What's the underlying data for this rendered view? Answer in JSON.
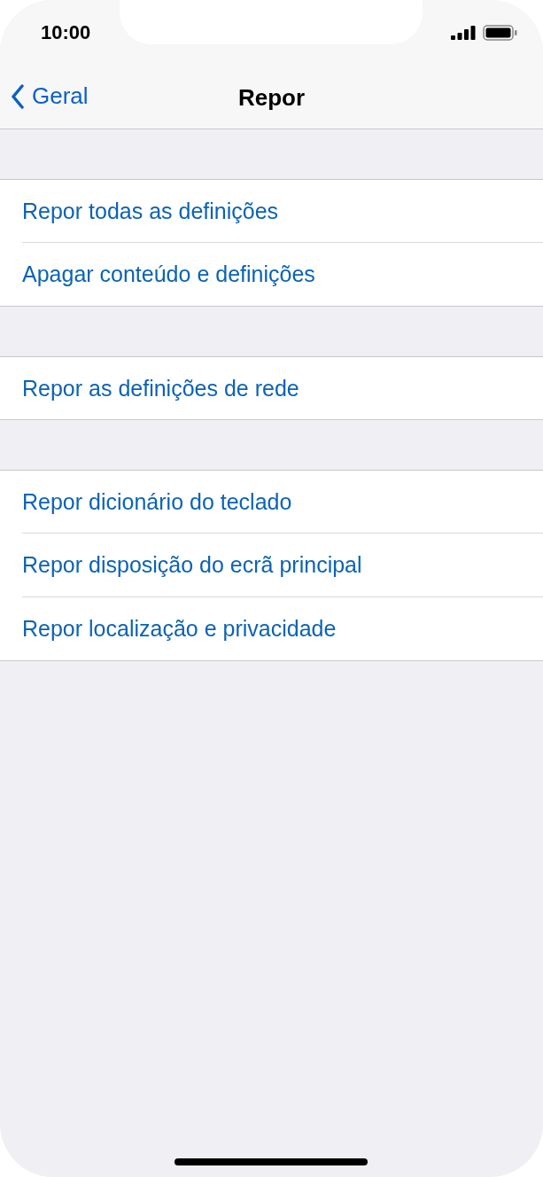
{
  "status_bar": {
    "time": "10:00"
  },
  "nav": {
    "back_label": "Geral",
    "title": "Repor"
  },
  "groups": [
    {
      "items": [
        "Repor todas as definições",
        "Apagar conteúdo e definições"
      ]
    },
    {
      "items": [
        "Repor as definições de rede"
      ]
    },
    {
      "items": [
        "Repor dicionário do teclado",
        "Repor disposição do ecrã principal",
        "Repor localização e privacidade"
      ]
    }
  ]
}
